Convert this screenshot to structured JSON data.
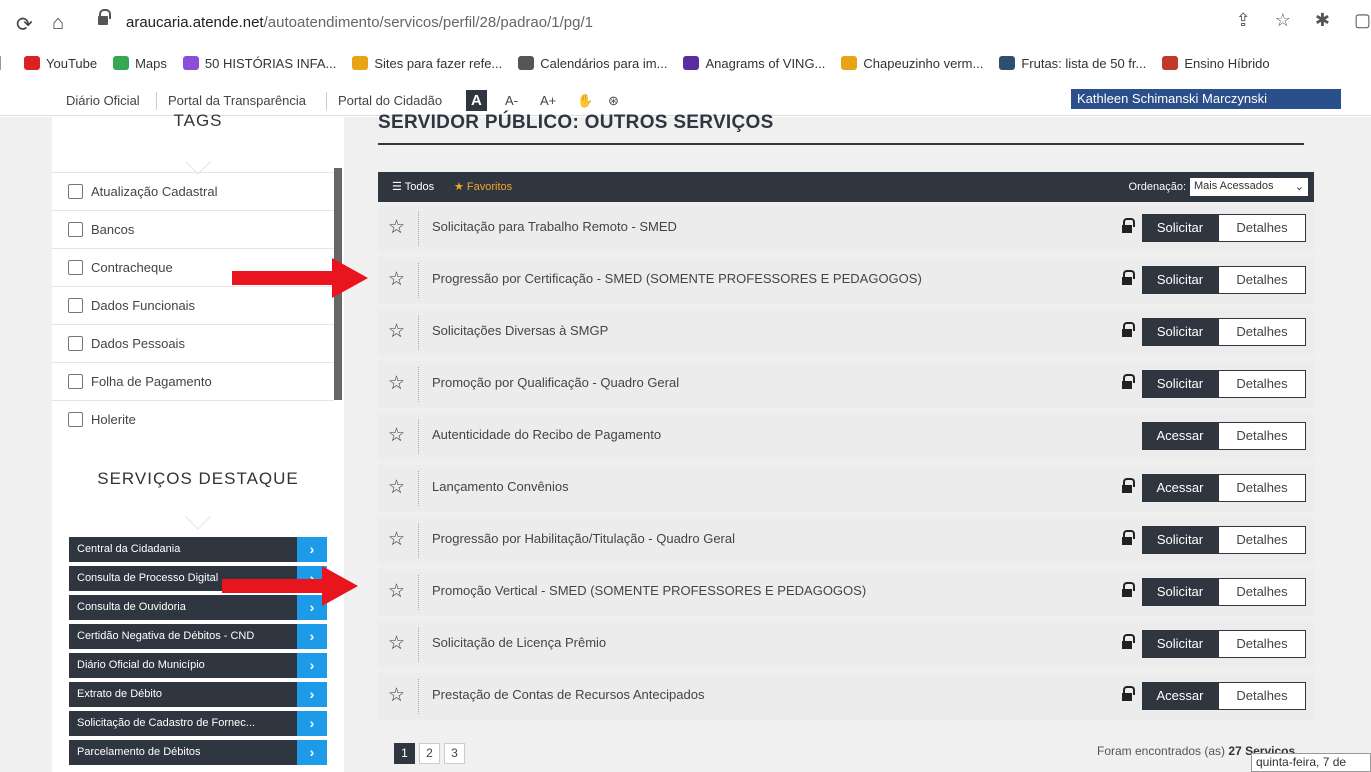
{
  "browser": {
    "url_host": "araucaria.atende.net",
    "url_path": "/autoatendimento/servicos/perfil/28/padrao/1/pg/1",
    "bookmarks": [
      {
        "label": "YouTube",
        "icon": "youtube-icon",
        "color": "#e02020"
      },
      {
        "label": "Maps",
        "icon": "maps-icon",
        "color": "#34a853"
      },
      {
        "label": "50 HISTÓRIAS INFA...",
        "icon": "heart-icon",
        "color": "#8a4fd8"
      },
      {
        "label": "Sites para fazer refe...",
        "icon": "puzzle-icon",
        "color": "#e8a317"
      },
      {
        "label": "Calendários para im...",
        "icon": "face-icon",
        "color": "#555555"
      },
      {
        "label": "Anagrams of VING...",
        "icon": "w-icon",
        "color": "#5b2ca0"
      },
      {
        "label": "Chapeuzinho verm...",
        "icon": "hood-icon",
        "color": "#e8a317"
      },
      {
        "label": "Frutas: lista de 50 fr...",
        "icon": "image-icon",
        "color": "#2f4f6f"
      },
      {
        "label": "Ensino Híbrido",
        "icon": "bear-icon",
        "color": "#c0392b"
      }
    ]
  },
  "site_top": {
    "links": [
      "Diário Oficial",
      "Portal da Transparência",
      "Portal do Cidadão"
    ],
    "font_big": "A",
    "font_minus": "A-",
    "font_plus": "A+",
    "user_name": "Kathleen Schimanski Marczynski"
  },
  "sidebar": {
    "tags_title": "TAGS",
    "tags": [
      "Atualização Cadastral",
      "Bancos",
      "Contracheque",
      "Dados Funcionais",
      "Dados Pessoais",
      "Folha de Pagamento",
      "Holerite"
    ],
    "destaque_title": "SERVIÇOS DESTAQUE",
    "destaque": [
      "Central da Cidadania",
      "Consulta de Processo Digital",
      "Consulta de Ouvidoria",
      "Certidão Negativa de Débitos - CND",
      "Diário Oficial do Município",
      "Extrato de Débito",
      "Solicitação de Cadastro de Fornec...",
      "Parcelamento de Débitos"
    ]
  },
  "main": {
    "title": "SERVIDOR PÚBLICO: OUTROS SERVIÇOS",
    "toolbar": {
      "todos": "Todos",
      "favoritos": "Favoritos",
      "ordenacao_label": "Ordenação:",
      "ordenacao_value": "Mais Acessados"
    },
    "services": [
      {
        "name": "Solicitação para Trabalho Remoto - SMED",
        "action": "Solicitar",
        "locked": true
      },
      {
        "name": "Progressão por Certificação - SMED (SOMENTE PROFESSORES E PEDAGOGOS)",
        "action": "Solicitar",
        "locked": true
      },
      {
        "name": "Solicitações Diversas à SMGP",
        "action": "Solicitar",
        "locked": true
      },
      {
        "name": "Promoção por Qualificação - Quadro Geral",
        "action": "Solicitar",
        "locked": true
      },
      {
        "name": "Autenticidade do Recibo de Pagamento",
        "action": "Acessar",
        "locked": false
      },
      {
        "name": "Lançamento Convênios",
        "action": "Acessar",
        "locked": true
      },
      {
        "name": "Progressão por Habilitação/Titulação - Quadro Geral",
        "action": "Solicitar",
        "locked": true
      },
      {
        "name": "Promoção Vertical - SMED (SOMENTE PROFESSORES E PEDAGOGOS)",
        "action": "Solicitar",
        "locked": true
      },
      {
        "name": "Solicitação de Licença Prêmio",
        "action": "Solicitar",
        "locked": true
      },
      {
        "name": "Prestação de Contas de Recursos Antecipados",
        "action": "Acessar",
        "locked": true
      }
    ],
    "details_label": "Detalhes",
    "pages": [
      "1",
      "2",
      "3"
    ],
    "found_prefix": "Foram encontrados (as)",
    "found_count": "27",
    "found_suffix": "Serviços"
  },
  "tooltip": "quinta-feira, 7 de",
  "colors": {
    "dark": "#2f3640",
    "accent_blue": "#1e9be8",
    "arrow_red": "#e8141e",
    "favorite": "#f5a623"
  }
}
